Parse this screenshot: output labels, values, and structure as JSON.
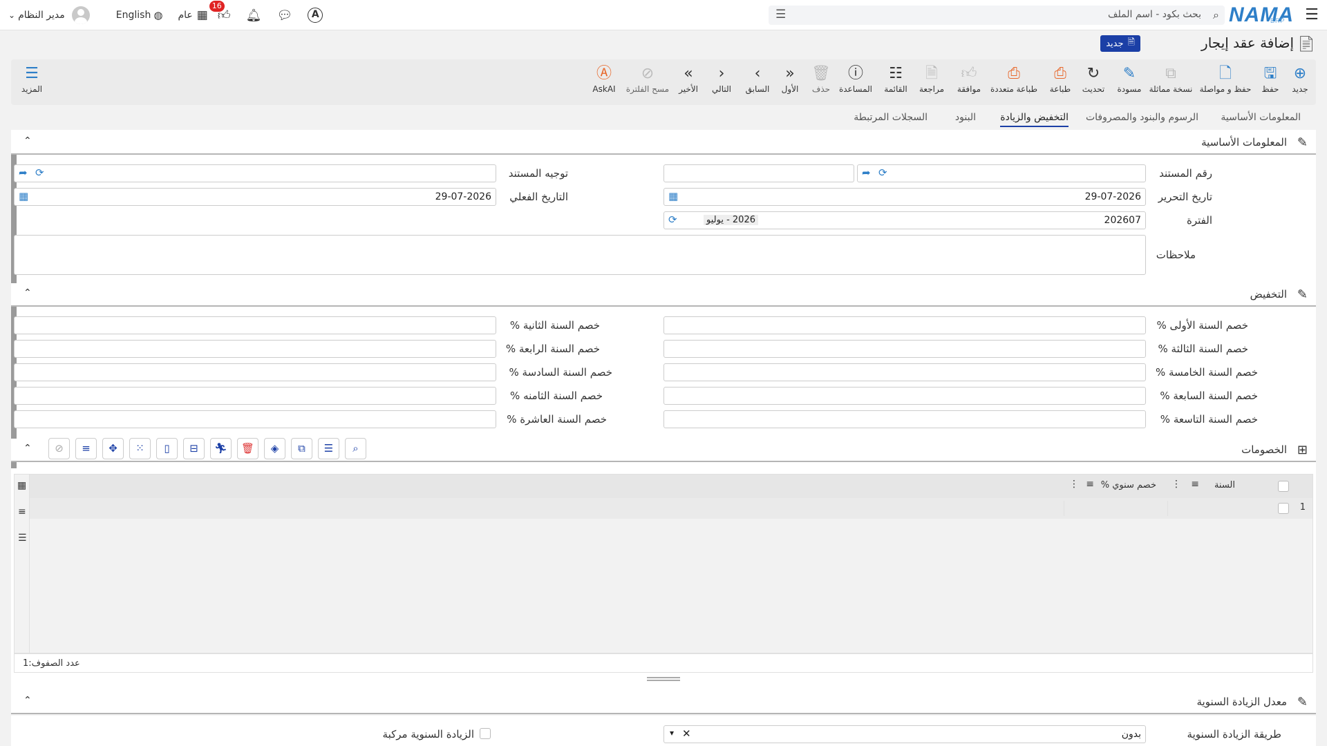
{
  "topbar": {
    "logo": "NAMA",
    "logo_sub": "ERP",
    "search_placeholder": "بحث بكود - اسم الملف",
    "user_name": "مدير النظام",
    "language": "English",
    "scope": "عام",
    "notifications_count": "16"
  },
  "page": {
    "title": "إضافة عقد إيجار",
    "status_badge": "جديد"
  },
  "toolbar": {
    "buttons": [
      {
        "label": "جديد",
        "icon": "plus-circle-icon"
      },
      {
        "label": "حفظ",
        "icon": "save-icon"
      },
      {
        "label": "حفظ و مواصلة",
        "icon": "save-continue-icon"
      },
      {
        "label": "نسخة مماثلة",
        "icon": "copy-icon"
      },
      {
        "label": "مسودة",
        "icon": "draft-icon"
      },
      {
        "label": "تحديث",
        "icon": "refresh-icon"
      },
      {
        "label": "طباعة",
        "icon": "print-icon"
      },
      {
        "label": "طباعة متعددة",
        "icon": "multi-print-icon"
      },
      {
        "label": "موافقة",
        "icon": "approve-icon"
      },
      {
        "label": "مراجعة",
        "icon": "review-icon"
      },
      {
        "label": "القائمة",
        "icon": "list-icon"
      },
      {
        "label": "المساعدة",
        "icon": "help-icon"
      },
      {
        "label": "حذف",
        "icon": "trash-icon"
      },
      {
        "label": "الأول",
        "icon": "first-icon"
      },
      {
        "label": "السابق",
        "icon": "previous-icon"
      },
      {
        "label": "التالي",
        "icon": "next-icon"
      },
      {
        "label": "الأخير",
        "icon": "last-icon"
      },
      {
        "label": "مسح الفلترة",
        "icon": "clear-filter-icon"
      },
      {
        "label": "AskAI",
        "icon": "ai-icon"
      }
    ],
    "more_label": "المزيد"
  },
  "tabs": [
    {
      "label": "المعلومات الأساسية",
      "active": false
    },
    {
      "label": "الرسوم والبنود والمصروفات",
      "active": false
    },
    {
      "label": "التخفيض والزيادة",
      "active": true
    },
    {
      "label": "البنود",
      "active": false
    },
    {
      "label": "السجلات المرتبطة",
      "active": false
    }
  ],
  "basic_info": {
    "section_title": "المعلومات الأساسية",
    "doc_number_label": "رقم المستند",
    "doc_direction_label": "توجيه المستند",
    "edit_date_label": "تاريخ التحرير",
    "edit_date_value": "29-07-2026",
    "actual_date_label": "التاريخ الفعلي",
    "actual_date_value": "29-07-2026",
    "period_label": "الفترة",
    "period_code": "202607",
    "period_name": "2026 - يوليو",
    "notes_label": "ملاحظات"
  },
  "discount": {
    "section_title": "التخفيض",
    "fields": [
      "خصم السنة الأولى %",
      "خصم السنة الثانية %",
      "خصم السنة الثالثة %",
      "خصم السنة الرابعة %",
      "خصم السنة الخامسة %",
      "خصم السنة السادسة %",
      "خصم السنة السابعة %",
      "خصم السنة الثامنه %",
      "خصم السنة التاسعة %",
      "خصم السنة العاشرة %"
    ]
  },
  "discounts_grid": {
    "section_title": "الخصومات",
    "columns": [
      "السنة",
      "خصم سنوي %"
    ],
    "rows": [
      {
        "index": "1",
        "year": "",
        "discount": ""
      }
    ],
    "row_count_label": "عدد الصفوف:",
    "row_count": "1"
  },
  "annual_increase": {
    "section_title": "معدل الزيادة السنوية",
    "method_label": "طريقة الزيادة السنوية",
    "method_value": "بدون",
    "compound_label": "الزيادة السنوية مركبة"
  }
}
